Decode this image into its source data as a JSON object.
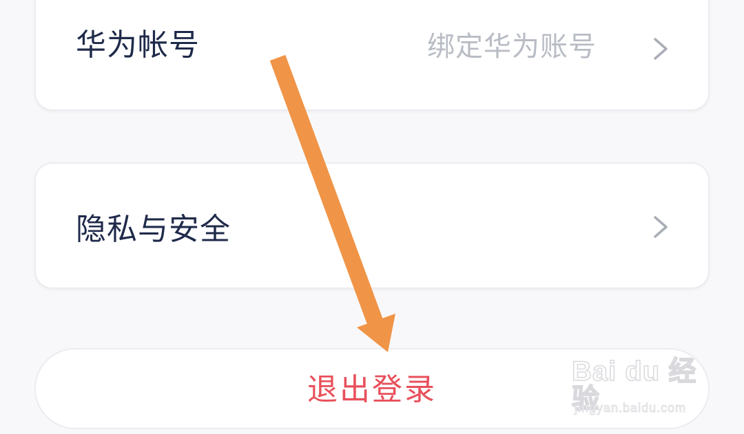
{
  "account_card": {
    "label": "华为帐号",
    "value": "绑定华为账号",
    "chevron_icon": "chevron-right-icon"
  },
  "privacy_card": {
    "label": "隐私与安全",
    "chevron_icon": "chevron-right-icon"
  },
  "logout": {
    "label": "退出登录",
    "color": "#e8505b"
  },
  "annotation": {
    "icon": "arrow-down-icon",
    "color": "#f09447"
  },
  "watermark": {
    "logo_text": "Bai du 经验",
    "url": "jingyan.baidu.com"
  }
}
